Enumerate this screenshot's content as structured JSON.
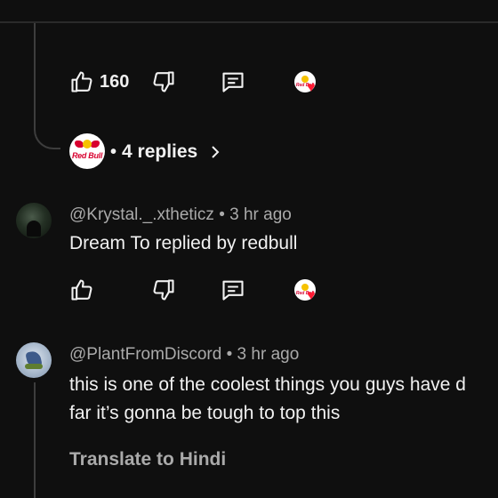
{
  "thread": {
    "top_comment_actions": {
      "like_count": "160"
    },
    "creator_badge": {
      "logo_text": "Red Bull"
    },
    "replies_link": {
      "separator": "•",
      "label": "4 replies",
      "chevron": "chevron-right-icon"
    }
  },
  "comments": [
    {
      "handle": "@Krystal._.xtheticz",
      "separator": "•",
      "time": "3 hr ago",
      "text_lines": [
        "Dream To replied by redbull"
      ]
    },
    {
      "handle": "@PlantFromDiscord",
      "separator": "•",
      "time": "3 hr ago",
      "text_lines": [
        "this is one of the coolest things you guys have d",
        "far it’s gonna be tough to top this"
      ],
      "translate_label": "Translate to Hindi"
    }
  ],
  "icons": {
    "like": "thumbs-up-icon",
    "dislike": "thumbs-down-icon",
    "reply": "comment-icon",
    "creator_heart": "red-heart-icon"
  },
  "colors": {
    "background": "#0f0f0f",
    "primary_text": "#f1f1f1",
    "secondary_text": "#aaaaaa",
    "heart": "#ff1a33",
    "brand_red": "#d8002f",
    "brand_yellow": "#f6c200"
  }
}
